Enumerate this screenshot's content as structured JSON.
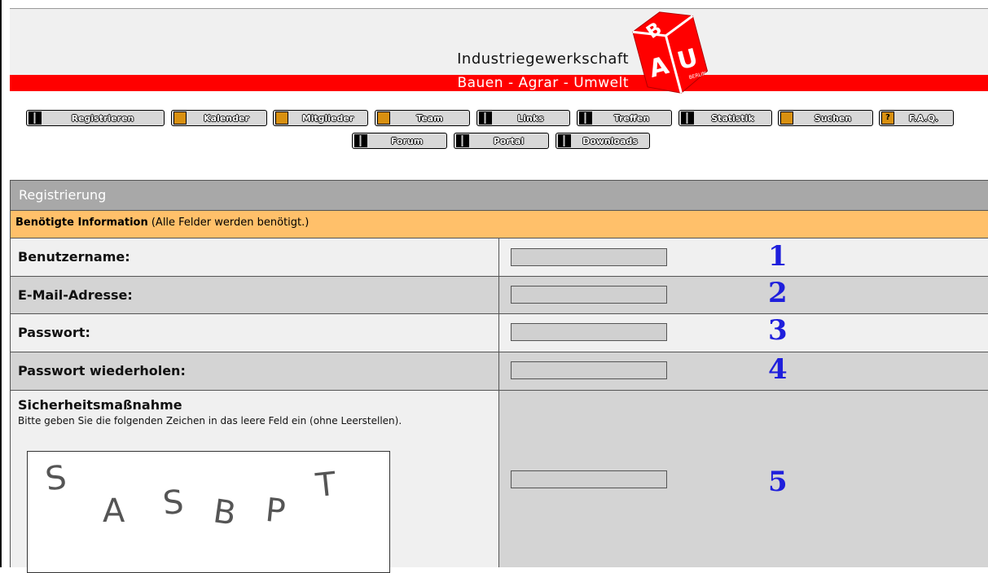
{
  "header": {
    "title": "Industriegewerkschaft",
    "subtitle": "Bauen - Agrar - Umwelt",
    "logo_text": "BERLIN"
  },
  "nav": {
    "row1": [
      {
        "label": "Registrieren",
        "icon": "book-icon"
      },
      {
        "label": "Kalender",
        "icon": "calendar-icon"
      },
      {
        "label": "Mitglieder",
        "icon": "members-icon"
      },
      {
        "label": "Team",
        "icon": "team-icon"
      },
      {
        "label": "Links",
        "icon": "book-icon"
      },
      {
        "label": "Treffen",
        "icon": "book-icon"
      },
      {
        "label": "Statistik",
        "icon": "book-icon"
      },
      {
        "label": "Suchen",
        "icon": "search-icon"
      },
      {
        "label": "F.A.Q.",
        "icon": "help-icon"
      }
    ],
    "row2": [
      {
        "label": "Forum",
        "icon": "book-icon"
      },
      {
        "label": "Portal",
        "icon": "book-icon"
      },
      {
        "label": "Downloads",
        "icon": "book-icon"
      }
    ]
  },
  "form": {
    "section_title": "Registrierung",
    "info_bold": "Benötigte Information",
    "info_rest": " (Alle Felder werden benötigt.)",
    "fields": [
      {
        "label": "Benutzername:",
        "value": "",
        "marker": "1"
      },
      {
        "label": "E-Mail-Adresse:",
        "value": "",
        "marker": "2"
      },
      {
        "label": "Passwort:",
        "value": "",
        "marker": "3"
      },
      {
        "label": "Passwort wiederholen:",
        "value": "",
        "marker": "4"
      }
    ],
    "captcha": {
      "title": "Sicherheitsmaßnahme",
      "hint": "Bitte geben Sie die folgenden Zeichen in das leere Feld ein (ohne Leerstellen).",
      "chars": [
        "S",
        "A",
        "S",
        "B",
        "P",
        "T"
      ],
      "marker": "5"
    }
  }
}
